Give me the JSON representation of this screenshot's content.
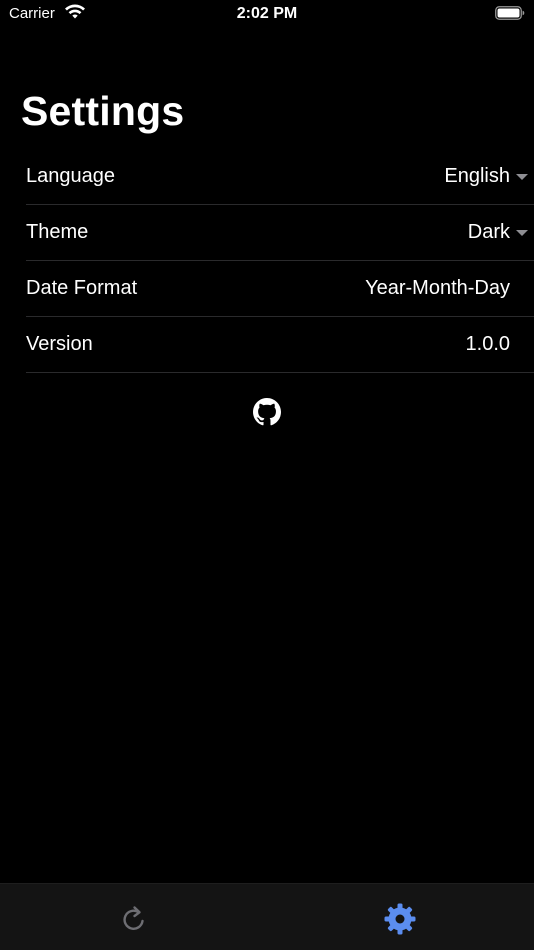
{
  "status_bar": {
    "carrier": "Carrier",
    "time": "2:02 PM"
  },
  "title": "Settings",
  "settings": [
    {
      "label": "Language",
      "value": "English",
      "dropdown": true
    },
    {
      "label": "Theme",
      "value": "Dark",
      "dropdown": true
    },
    {
      "label": "Date Format",
      "value": "Year-Month-Day",
      "dropdown": false
    },
    {
      "label": "Version",
      "value": "1.0.0",
      "dropdown": false
    }
  ],
  "icons": {
    "github": "github-icon",
    "tab_refresh": "refresh-icon",
    "tab_settings": "gear-icon"
  },
  "colors": {
    "background": "#000000",
    "tab_bar": "#141414",
    "active_tab": "#5b8def",
    "inactive_tab": "#8e8e93",
    "separator": "#2a2a2c"
  }
}
